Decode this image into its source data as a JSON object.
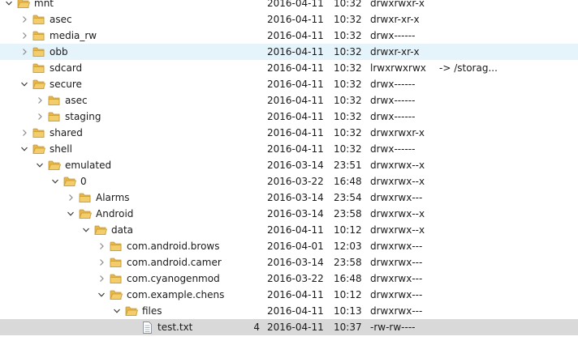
{
  "rows": [
    {
      "name": "mnt",
      "depth": 0,
      "type": "folder",
      "state": "expanded",
      "size": "",
      "date": "2016-04-11",
      "time": "10:32",
      "perm": "drwxrwxr-x",
      "info": ""
    },
    {
      "name": "asec",
      "depth": 1,
      "type": "folder",
      "state": "collapsed",
      "size": "",
      "date": "2016-04-11",
      "time": "10:32",
      "perm": "drwxr-xr-x",
      "info": ""
    },
    {
      "name": "media_rw",
      "depth": 1,
      "type": "folder",
      "state": "collapsed",
      "size": "",
      "date": "2016-04-11",
      "time": "10:32",
      "perm": "drwx------",
      "info": ""
    },
    {
      "name": "obb",
      "depth": 1,
      "type": "folder",
      "state": "collapsed",
      "size": "",
      "date": "2016-04-11",
      "time": "10:32",
      "perm": "drwxr-xr-x",
      "info": "",
      "highlight": "hover"
    },
    {
      "name": "sdcard",
      "depth": 1,
      "type": "folder",
      "state": "none",
      "size": "",
      "date": "2016-04-11",
      "time": "10:32",
      "perm": "lrwxrwxrwx",
      "info": "-> /storag..."
    },
    {
      "name": "secure",
      "depth": 1,
      "type": "folder",
      "state": "expanded",
      "size": "",
      "date": "2016-04-11",
      "time": "10:32",
      "perm": "drwx------",
      "info": ""
    },
    {
      "name": "asec",
      "depth": 2,
      "type": "folder",
      "state": "collapsed",
      "size": "",
      "date": "2016-04-11",
      "time": "10:32",
      "perm": "drwx------",
      "info": ""
    },
    {
      "name": "staging",
      "depth": 2,
      "type": "folder",
      "state": "collapsed",
      "size": "",
      "date": "2016-04-11",
      "time": "10:32",
      "perm": "drwx------",
      "info": ""
    },
    {
      "name": "shared",
      "depth": 1,
      "type": "folder",
      "state": "collapsed",
      "size": "",
      "date": "2016-04-11",
      "time": "10:32",
      "perm": "drwxrwxr-x",
      "info": ""
    },
    {
      "name": "shell",
      "depth": 1,
      "type": "folder",
      "state": "expanded",
      "size": "",
      "date": "2016-04-11",
      "time": "10:32",
      "perm": "drwx------",
      "info": ""
    },
    {
      "name": "emulated",
      "depth": 2,
      "type": "folder",
      "state": "expanded",
      "size": "",
      "date": "2016-03-14",
      "time": "23:51",
      "perm": "drwxrwx--x",
      "info": ""
    },
    {
      "name": "0",
      "depth": 3,
      "type": "folder",
      "state": "expanded",
      "size": "",
      "date": "2016-03-22",
      "time": "16:48",
      "perm": "drwxrwx--x",
      "info": ""
    },
    {
      "name": "Alarms",
      "depth": 4,
      "type": "folder",
      "state": "collapsed",
      "size": "",
      "date": "2016-03-14",
      "time": "23:54",
      "perm": "drwxrwx---",
      "info": ""
    },
    {
      "name": "Android",
      "depth": 4,
      "type": "folder",
      "state": "expanded",
      "size": "",
      "date": "2016-03-14",
      "time": "23:58",
      "perm": "drwxrwx--x",
      "info": ""
    },
    {
      "name": "data",
      "depth": 5,
      "type": "folder",
      "state": "expanded",
      "size": "",
      "date": "2016-04-11",
      "time": "10:12",
      "perm": "drwxrwx--x",
      "info": ""
    },
    {
      "name": "com.android.brows",
      "depth": 6,
      "type": "folder",
      "state": "collapsed",
      "size": "",
      "date": "2016-04-01",
      "time": "12:03",
      "perm": "drwxrwx---",
      "info": ""
    },
    {
      "name": "com.android.camer",
      "depth": 6,
      "type": "folder",
      "state": "collapsed",
      "size": "",
      "date": "2016-03-14",
      "time": "23:58",
      "perm": "drwxrwx---",
      "info": ""
    },
    {
      "name": "com.cyanogenmod",
      "depth": 6,
      "type": "folder",
      "state": "collapsed",
      "size": "",
      "date": "2016-03-22",
      "time": "16:48",
      "perm": "drwxrwx---",
      "info": ""
    },
    {
      "name": "com.example.chens",
      "depth": 6,
      "type": "folder",
      "state": "expanded",
      "size": "",
      "date": "2016-04-11",
      "time": "10:12",
      "perm": "drwxrwx---",
      "info": ""
    },
    {
      "name": "files",
      "depth": 7,
      "type": "folder",
      "state": "expanded",
      "size": "",
      "date": "2016-04-11",
      "time": "10:13",
      "perm": "drwxrwx---",
      "info": ""
    },
    {
      "name": "test.txt",
      "depth": 8,
      "type": "file",
      "state": "none",
      "size": "4",
      "date": "2016-04-11",
      "time": "10:37",
      "perm": "-rw-rw----",
      "info": "",
      "highlight": "selected"
    }
  ],
  "colors": {
    "folder_fill": "#f3cc6b",
    "folder_edge": "#c89b2c",
    "hover_bg": "#e5f3fb",
    "selected_bg": "#d9d9d9"
  },
  "icons": {
    "expanded": "chevron-down-icon",
    "collapsed": "chevron-right-icon",
    "folder": "folder-icon",
    "file": "file-icon"
  }
}
